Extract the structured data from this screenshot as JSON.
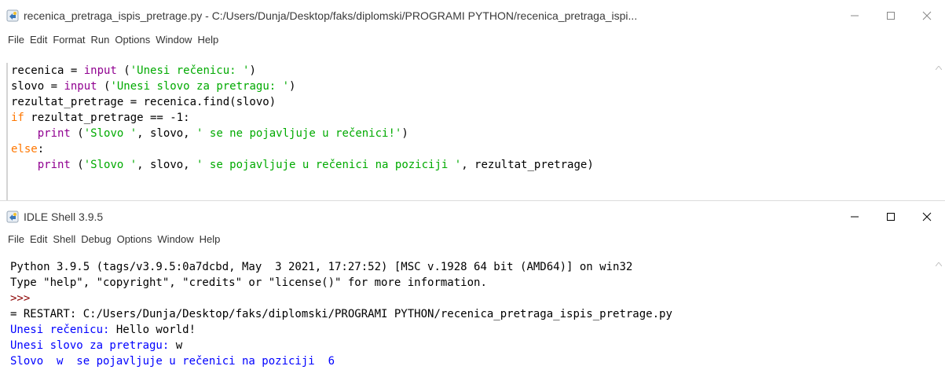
{
  "editor": {
    "title": "recenica_pretraga_ispis_pretrage.py - C:/Users/Dunja/Desktop/faks/diplomski/PROGRAMI PYTHON/recenica_pretraga_ispi...",
    "menu": [
      "File",
      "Edit",
      "Format",
      "Run",
      "Options",
      "Window",
      "Help"
    ],
    "code": {
      "l1a": "recenica = ",
      "l1b": "input",
      "l1c": " (",
      "l1d": "'Unesi rečenicu: '",
      "l1e": ")",
      "l2a": "slovo = ",
      "l2b": "input",
      "l2c": " (",
      "l2d": "'Unesi slovo za pretragu: '",
      "l2e": ")",
      "l3": "rezultat_pretrage = recenica.find(slovo)",
      "l4a": "if",
      "l4b": " rezultat_pretrage == -1:",
      "l5a": "    ",
      "l5b": "print",
      "l5c": " (",
      "l5d": "'Slovo '",
      "l5e": ", slovo, ",
      "l5f": "' se ne pojavljuje u rečenici!'",
      "l5g": ")",
      "l6a": "else",
      "l6b": ":",
      "l7a": "    ",
      "l7b": "print",
      "l7c": " (",
      "l7d": "'Slovo '",
      "l7e": ", slovo, ",
      "l7f": "' se pojavljuje u rečenici na poziciji '",
      "l7g": ", rezultat_pretrage)"
    }
  },
  "shell": {
    "title": "IDLE Shell 3.9.5",
    "menu": [
      "File",
      "Edit",
      "Shell",
      "Debug",
      "Options",
      "Window",
      "Help"
    ],
    "lines": {
      "banner1": "Python 3.9.5 (tags/v3.9.5:0a7dcbd, May  3 2021, 17:27:52) [MSC v.1928 64 bit (AMD64)] on win32",
      "banner2": "Type \"help\", \"copyright\", \"credits\" or \"license()\" for more information.",
      "prompt": ">>>",
      "restart": "= RESTART: C:/Users/Dunja/Desktop/faks/diplomski/PROGRAMI PYTHON/recenica_pretraga_ispis_pretrage.py",
      "in1_prompt": "Unesi rečenicu: ",
      "in1_value": "Hello world!",
      "in2_prompt": "Unesi slovo za pretragu: ",
      "in2_value": "w",
      "result": "Slovo  w  se pojavljuje u rečenici na poziciji  6"
    }
  },
  "colors": {
    "keyword": "#ff7700",
    "builtin": "#900090",
    "string": "#00aa00",
    "output": "#0000ff",
    "prompt": "#8b0000"
  },
  "icons": [
    "python-file-icon",
    "minimize-icon",
    "maximize-icon",
    "close-icon",
    "scroll-up-arrow-icon"
  ]
}
